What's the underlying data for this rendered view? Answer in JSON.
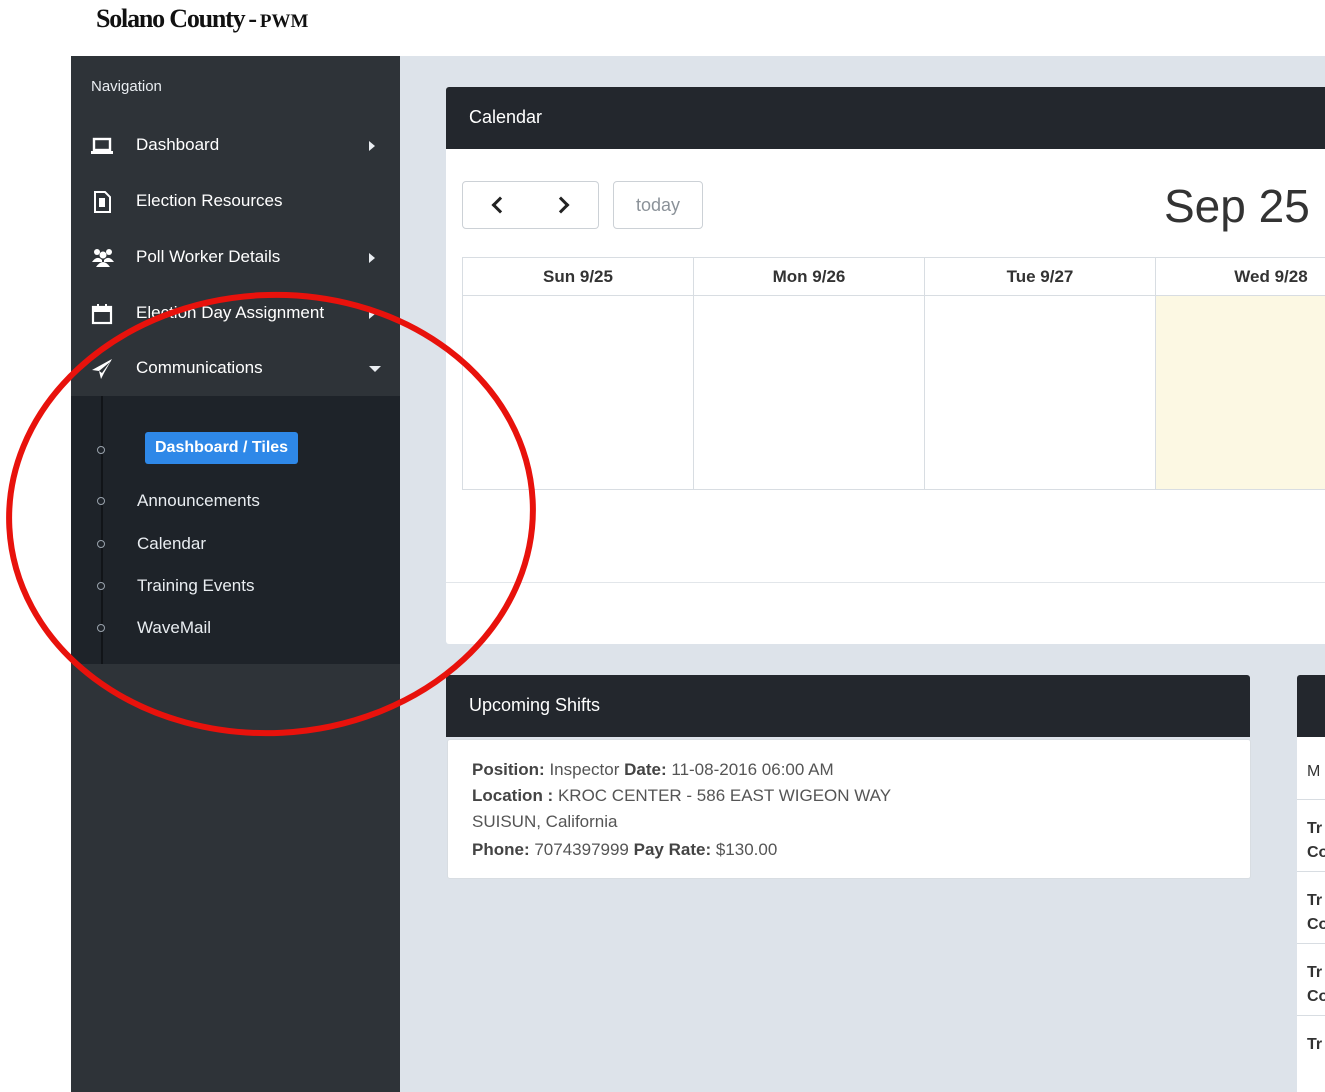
{
  "brand": {
    "main": "Solano County",
    "separator": "-",
    "sub": "PWM"
  },
  "sidebar": {
    "caption": "Navigation",
    "items": [
      {
        "label": "Dashboard",
        "icon": "laptop-icon",
        "has_submenu": true,
        "expanded": false
      },
      {
        "label": "Election Resources",
        "icon": "file-icon",
        "has_submenu": false
      },
      {
        "label": "Poll Worker Details",
        "icon": "users-icon",
        "has_submenu": true,
        "expanded": false
      },
      {
        "label": "Election Day Assignment",
        "icon": "calendar-icon",
        "has_submenu": true,
        "expanded": false
      },
      {
        "label": "Communications",
        "icon": "paper-plane-icon",
        "has_submenu": true,
        "expanded": true
      }
    ],
    "submenu": [
      {
        "label": "Dashboard / Tiles",
        "active": true
      },
      {
        "label": "Announcements"
      },
      {
        "label": "Calendar"
      },
      {
        "label": "Training Events"
      },
      {
        "label": "WaveMail"
      }
    ]
  },
  "calendar": {
    "panel_title": "Calendar",
    "today_label": "today",
    "title": "Sep 25",
    "days": [
      {
        "label": "Sun 9/25",
        "today": false
      },
      {
        "label": "Mon 9/26",
        "today": false
      },
      {
        "label": "Tue 9/27",
        "today": false
      },
      {
        "label": "Wed 9/28",
        "today": true
      }
    ]
  },
  "shifts": {
    "panel_title": "Upcoming Shifts",
    "item": {
      "position_label": "Position:",
      "position": "Inspector",
      "date_label": "Date:",
      "date": "11-08-2016 06:00 AM",
      "location_label": "Location :",
      "location": "KROC CENTER - 586 EAST WIGEON WAY",
      "city": "SUISUN, California",
      "phone_label": "Phone:",
      "phone": "7074397999",
      "payrate_label": "Pay Rate:",
      "payrate": "$130.00"
    }
  },
  "right_panel": {
    "rows": [
      {
        "a": "M",
        "b": ""
      },
      {
        "a": "Tr",
        "b": "Co"
      },
      {
        "a": "Tr",
        "b": "Co"
      },
      {
        "a": "Tr",
        "b": "Co"
      },
      {
        "a": "Tr",
        "b": ""
      }
    ]
  },
  "colors": {
    "sidebar_bg": "#2e3338",
    "submenu_bg": "#1e2329",
    "panel_header": "#23272d",
    "content_bg": "#dde3ea",
    "accent": "#2e88e8",
    "today_bg": "#fcf8e3",
    "annotation": "#e8120c"
  }
}
